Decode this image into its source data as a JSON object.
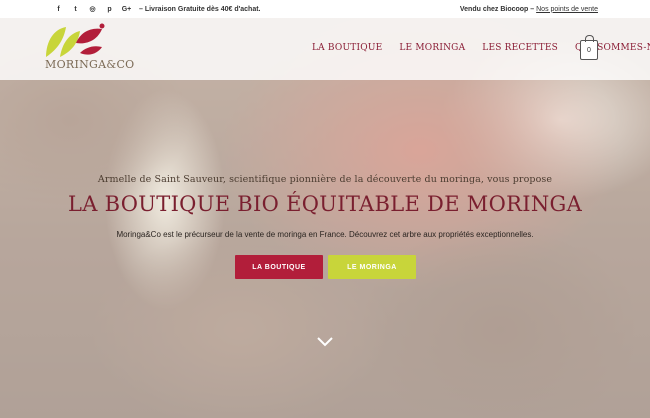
{
  "topbar": {
    "social": [
      {
        "icon": "facebook-icon",
        "glyph": "f"
      },
      {
        "icon": "twitter-icon",
        "glyph": "t"
      },
      {
        "icon": "instagram-icon",
        "glyph": "◎"
      },
      {
        "icon": "pinterest-icon",
        "glyph": "p"
      },
      {
        "icon": "googleplus-icon",
        "glyph": "G+"
      }
    ],
    "promo": "– Livraison Gratuite dès 40€ d'achat.",
    "sold_at": "Vendu chez Biocoop –",
    "points_link": "Nos points de vente"
  },
  "logo": {
    "text": "MORINGA&CO"
  },
  "nav": {
    "items": [
      "LA BOUTIQUE",
      "LE MORINGA",
      "LES RECETTES",
      "QUI SOMMES-NOUS"
    ]
  },
  "cart": {
    "count": "0"
  },
  "hero": {
    "intro": "Armelle de Saint Sauveur, scientifique pionnière de la découverte du moringa, vous propose",
    "headline": "LA BOUTIQUE BIO ÉQUITABLE DE MORINGA",
    "sub": "Moringa&Co est le précurseur de la vente de moringa en France. Découvrez cet arbre aux propriétés exceptionnelles.",
    "btn_shop": "LA BOUTIQUE",
    "btn_moringa": "LE MORINGA"
  },
  "colors": {
    "brand_red": "#b21e3a",
    "brand_green": "#c8d53a",
    "nav_text": "#8b1e36"
  }
}
